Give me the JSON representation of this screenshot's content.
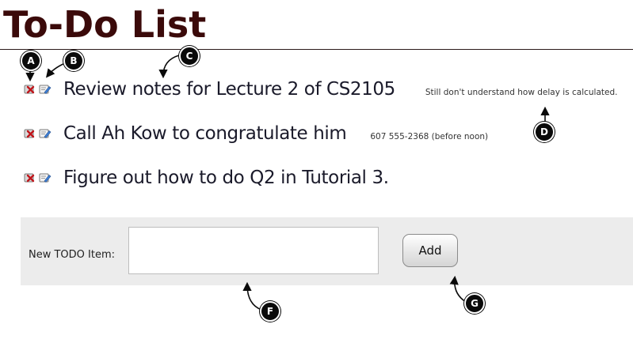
{
  "title": "To-Do List",
  "items": [
    {
      "text": "Review notes for Lecture 2 of CS2105",
      "note": "Still don't understand how delay is calculated.",
      "delete_icon": "delete-icon",
      "edit_icon": "edit-icon"
    },
    {
      "text": "Call Ah Kow to congratulate him",
      "note": "607 555-2368 (before noon)",
      "delete_icon": "delete-icon",
      "edit_icon": "edit-icon"
    },
    {
      "text": "Figure out how to do Q2 in Tutorial 3.",
      "note": "",
      "delete_icon": "delete-icon",
      "edit_icon": "edit-icon"
    }
  ],
  "form": {
    "label": "New TODO Item:",
    "input_value": "",
    "add_label": "Add"
  },
  "callouts": {
    "a": "A",
    "b": "B",
    "c": "C",
    "d": "D",
    "f": "F",
    "g": "G"
  },
  "colors": {
    "title": "#3b0a0a",
    "panel": "#ececec",
    "marker": "#0a0a0a"
  }
}
